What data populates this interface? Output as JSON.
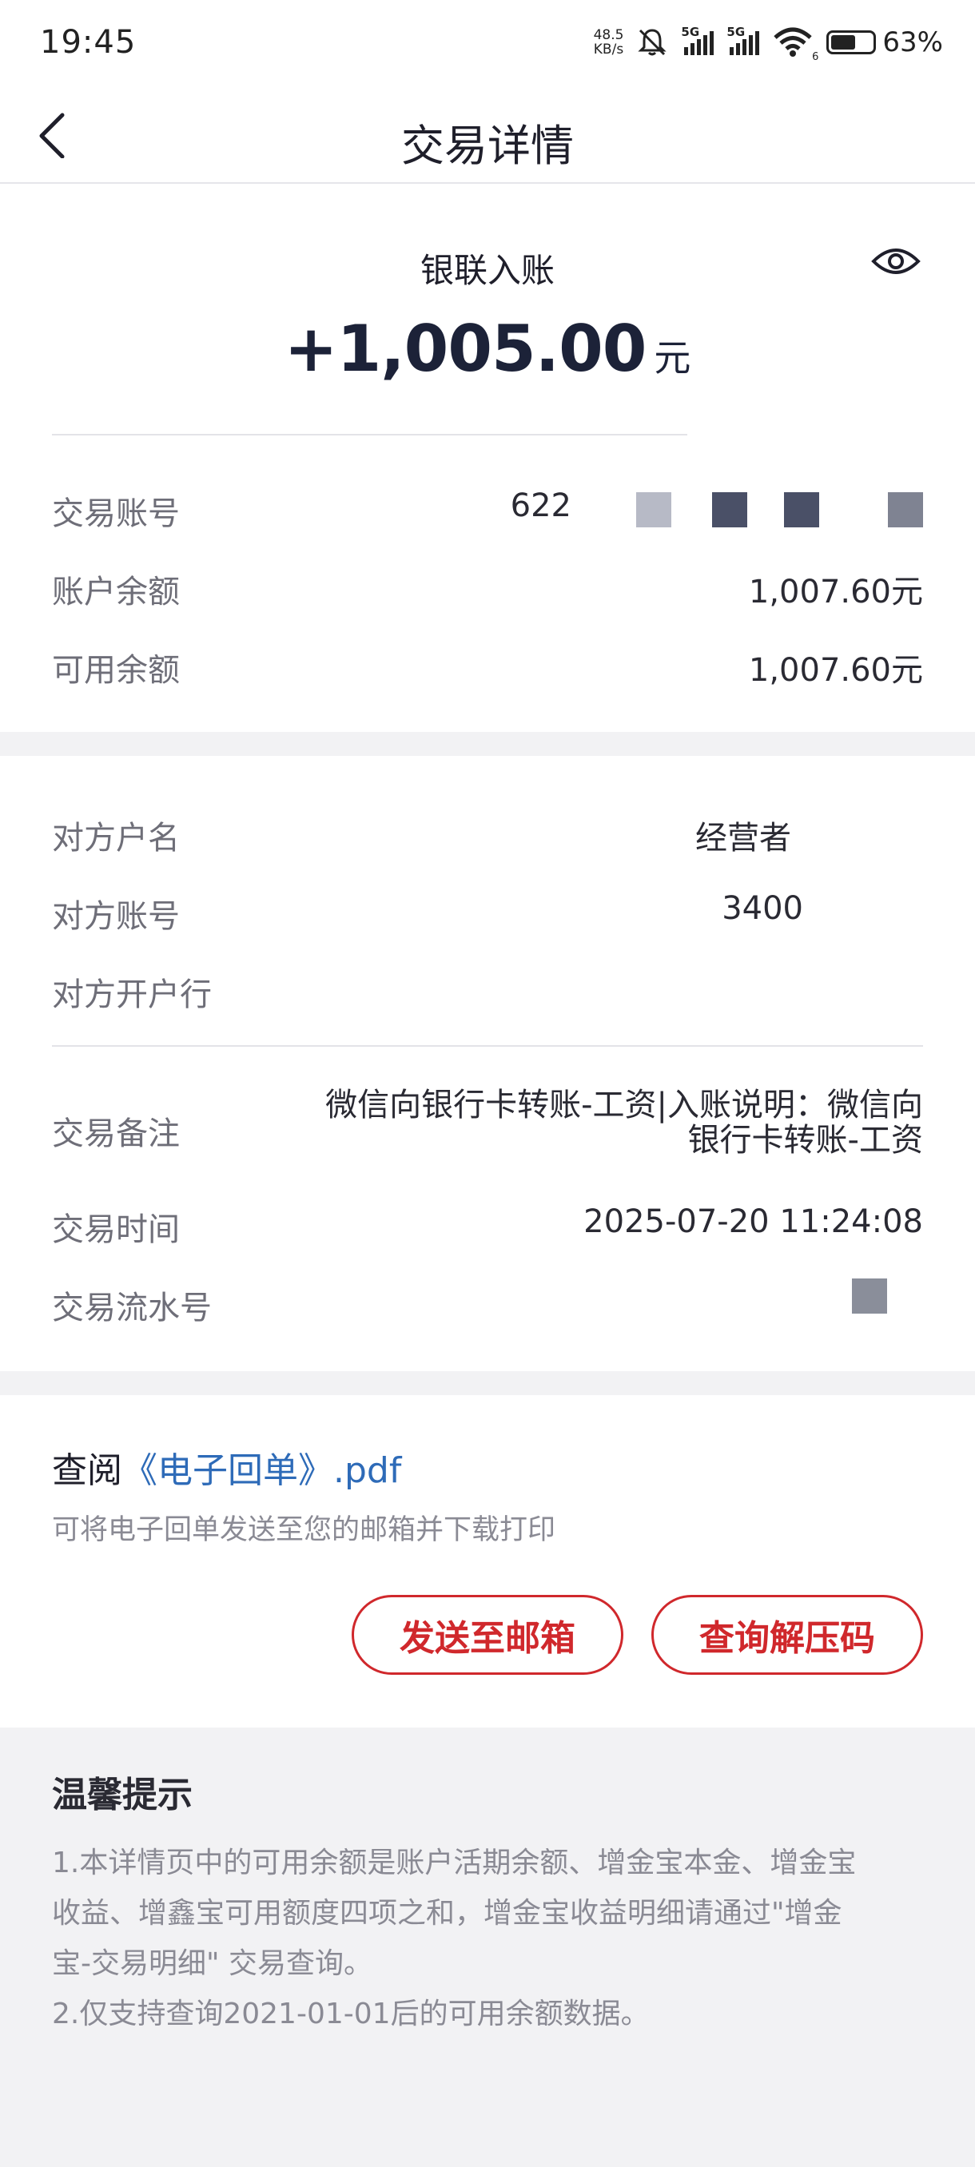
{
  "status_bar": {
    "time": "19:45",
    "net_speed_value": "48.5",
    "net_speed_unit": "KB/s",
    "sim1_label": "5G",
    "sim2_label": "5G",
    "wifi_sub": "6",
    "battery_percent": "63%",
    "battery_level": 0.63
  },
  "nav": {
    "title": "交易详情",
    "back_icon": "chevron-left-icon"
  },
  "summary": {
    "transaction_type": "银联入账",
    "amount": "+1,005.00",
    "currency_unit": "元",
    "eye_icon": "eye-icon"
  },
  "account_info": [
    {
      "label": "交易账号",
      "value": "622"
    },
    {
      "label": "账户余额",
      "value": "1,007.60元"
    },
    {
      "label": "可用余额",
      "value": "1,007.60元"
    }
  ],
  "counterparty": {
    "name_label": "对方户名",
    "name_value": "经营者",
    "account_label": "对方账号",
    "account_value": "3400",
    "bank_label": "对方开户行",
    "bank_value": "",
    "memo_label": "交易备注",
    "memo_line1": "微信向银行卡转账-工资|入账说明：微信向",
    "memo_line2": "银行卡转账-工资",
    "time_label": "交易时间",
    "time_value": "2025-07-20 11:24:08",
    "serial_label": "交易流水号"
  },
  "receipt": {
    "view_prefix": "查阅",
    "file_link": "《电子回单》.pdf",
    "description": "可将电子回单发送至您的邮箱并下载打印",
    "send_button": "发送至邮箱",
    "code_button": "查询解压码"
  },
  "tips": {
    "title": "温馨提示",
    "line1": "1.本详情页中的可用余额是账户活期余额、增金宝本金、增金宝",
    "line2": "收益、增鑫宝可用额度四项之和，增金宝收益明细请通过\"增金",
    "line3": "宝-交易明细\" 交易查询。",
    "line4": "2.仅支持查询2021-01-01后的可用余额数据。"
  },
  "colors": {
    "accent_red": "#d0282c",
    "link_blue": "#2e6bb8",
    "amount_navy": "#1c2238"
  }
}
